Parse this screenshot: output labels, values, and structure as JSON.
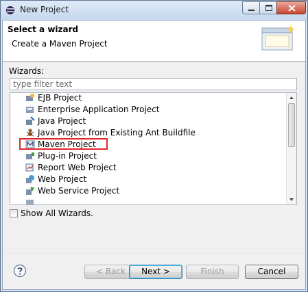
{
  "window": {
    "title": "New Project"
  },
  "banner": {
    "title": "Select a wizard",
    "description": "Create a Maven Project"
  },
  "wizards_label": "Wizards:",
  "filter": {
    "placeholder": "type filter text",
    "value": ""
  },
  "tree": {
    "items": [
      {
        "label": "EJB Project",
        "icon": "ejb-project-icon"
      },
      {
        "label": "Enterprise Application Project",
        "icon": "ear-project-icon"
      },
      {
        "label": "Java Project",
        "icon": "java-project-icon"
      },
      {
        "label": "Java Project from Existing Ant Buildfile",
        "icon": "ant-project-icon"
      },
      {
        "label": "Maven Project",
        "icon": "maven-project-icon",
        "highlighted": true
      },
      {
        "label": "Plug-in Project",
        "icon": "plugin-project-icon"
      },
      {
        "label": "Report Web Project",
        "icon": "report-web-project-icon"
      },
      {
        "label": "Web Project",
        "icon": "web-project-icon"
      },
      {
        "label": "Web Service Project",
        "icon": "web-service-project-icon"
      }
    ],
    "highlight_color": "#e0262d"
  },
  "show_all": {
    "label": "Show All Wizards.",
    "checked": false
  },
  "buttons": {
    "back": "< Back",
    "next": "Next >",
    "finish": "Finish",
    "cancel": "Cancel"
  }
}
